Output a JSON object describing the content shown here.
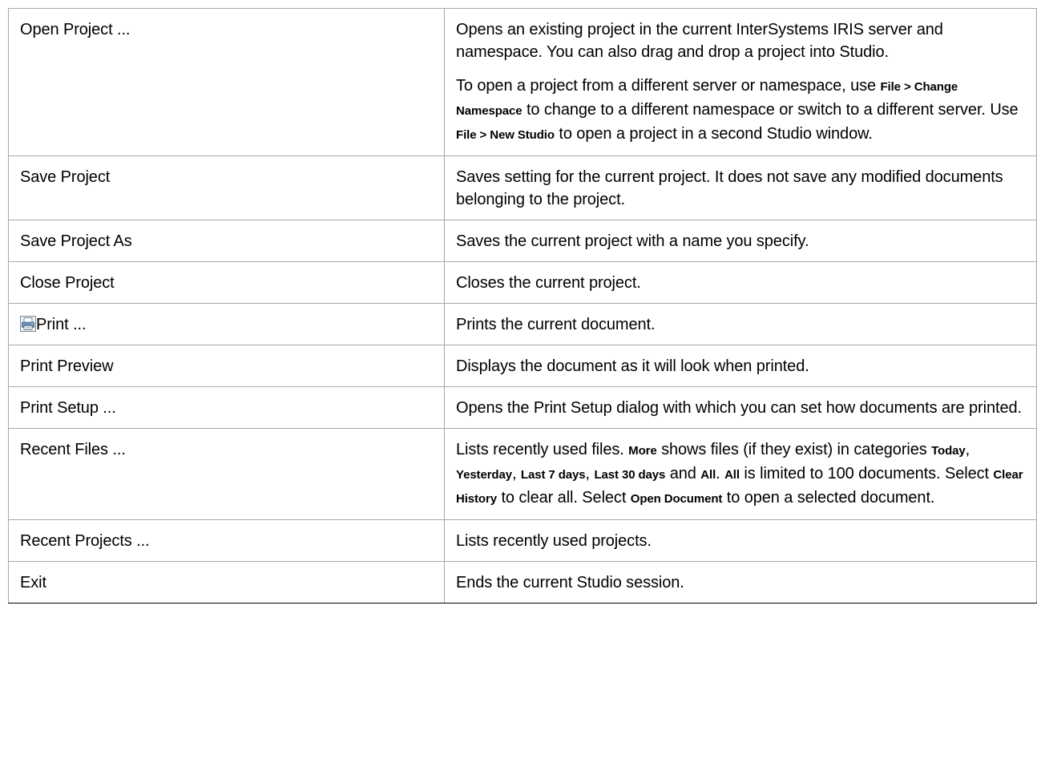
{
  "rows": [
    {
      "command": "Open Project ...",
      "description": [
        [
          {
            "t": "Opens an existing project in the current InterSystems IRIS server and namespace. You can also drag and drop a project into Studio."
          }
        ],
        [
          {
            "t": "To open a project from a different server or namespace, use "
          },
          {
            "t": "File > Change Namespace",
            "ui": true
          },
          {
            "t": " to change to a different namespace or switch to a different server. Use "
          },
          {
            "t": "File > New Studio",
            "ui": true
          },
          {
            "t": " to open a project in a second Studio window."
          }
        ]
      ]
    },
    {
      "command": "Save Project",
      "description": [
        [
          {
            "t": "Saves setting for the current project. It does not save any modified documents belonging to the project."
          }
        ]
      ]
    },
    {
      "command": "Save Project As",
      "description": [
        [
          {
            "t": "Saves the current project with a name you specify."
          }
        ]
      ]
    },
    {
      "command": "Close Project",
      "description": [
        [
          {
            "t": "Closes the current project."
          }
        ]
      ]
    },
    {
      "command": "Print ...",
      "icon": "printer-icon",
      "description": [
        [
          {
            "t": "Prints the current document."
          }
        ]
      ]
    },
    {
      "command": "Print Preview",
      "description": [
        [
          {
            "t": "Displays the document as it will look when printed."
          }
        ]
      ]
    },
    {
      "command": "Print Setup ...",
      "description": [
        [
          {
            "t": "Opens the Print Setup dialog with which you can set how documents are printed."
          }
        ]
      ]
    },
    {
      "command": "Recent Files ...",
      "description": [
        [
          {
            "t": "Lists recently used files. "
          },
          {
            "t": "More",
            "ui": true
          },
          {
            "t": " shows files (if they exist) in categories "
          },
          {
            "t": "Today",
            "ui": true
          },
          {
            "t": ", "
          },
          {
            "t": "Yesterday",
            "ui": true
          },
          {
            "t": ", "
          },
          {
            "t": "Last 7 days",
            "ui": true
          },
          {
            "t": ", "
          },
          {
            "t": "Last 30 days",
            "ui": true
          },
          {
            "t": " and "
          },
          {
            "t": "All",
            "ui": true
          },
          {
            "t": ". "
          },
          {
            "t": "All",
            "ui": true
          },
          {
            "t": " is limited to 100 documents. Select "
          },
          {
            "t": "Clear History",
            "ui": true
          },
          {
            "t": " to clear all. Select "
          },
          {
            "t": "Open Document",
            "ui": true
          },
          {
            "t": " to open a selected document."
          }
        ]
      ]
    },
    {
      "command": "Recent Projects ...",
      "description": [
        [
          {
            "t": "Lists recently used projects."
          }
        ]
      ]
    },
    {
      "command": "Exit",
      "description": [
        [
          {
            "t": "Ends the current Studio session."
          }
        ]
      ]
    }
  ]
}
